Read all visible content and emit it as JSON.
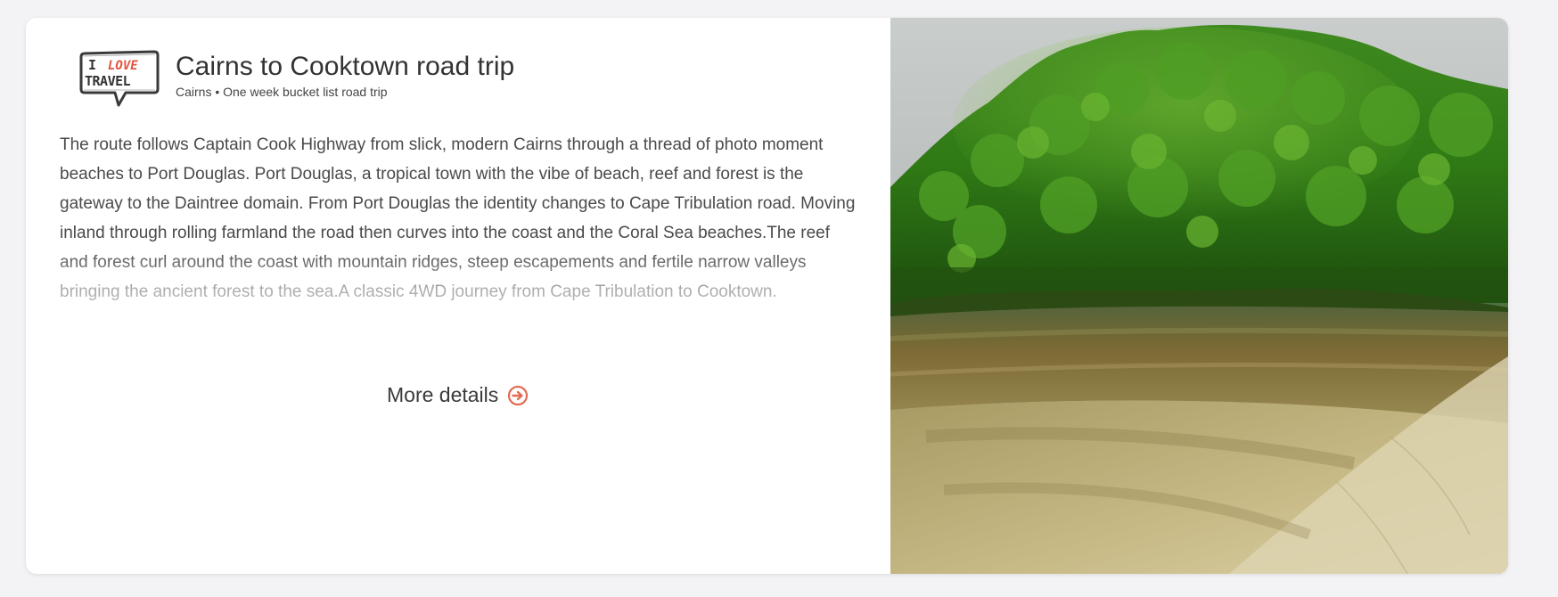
{
  "card": {
    "title": "Cairns to Cooktown road trip",
    "subtitle": "Cairns • One week bucket list road trip",
    "logo": {
      "line1_a": "I",
      "line1_b": "LOVE",
      "line2": "TRAVEL",
      "icon": "i-love-travel-logo"
    },
    "description": "The route follows Captain Cook Highway from slick, modern Cairns through a thread of photo moment beaches to Port Douglas.  Port Douglas, a tropical town with the vibe of beach, reef and forest is the gateway to the Daintree domain.  From Port Douglas the identity changes to Cape Tribulation road. Moving inland through rolling farmland the road then curves into the coast and the Coral Sea beaches.The reef and forest curl around the coast with mountain ridges, steep escapements and fertile narrow valleys bringing the ancient forest to the sea.A classic 4WD journey from Cape Tribulation to Cooktown.",
    "more_details_label": "More details",
    "more_details_icon": "arrow-circle-right-icon",
    "accent_color": "#e36b52",
    "photo_alt": "Rainforest meeting a sandy beach"
  }
}
